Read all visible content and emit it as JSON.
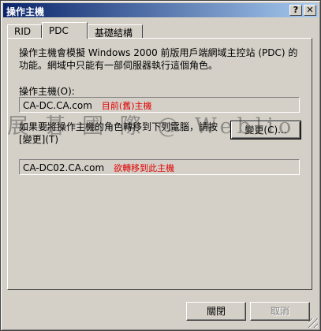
{
  "window": {
    "title": "操作主機",
    "help_glyph": "?",
    "close_glyph": "✕"
  },
  "tabs": [
    {
      "label": "RID",
      "active": false
    },
    {
      "label": "PDC",
      "active": true
    },
    {
      "label": "基礎結構",
      "active": false
    }
  ],
  "pdc": {
    "description": "操作主機會模擬 Windows 2000 前版用戶端網域主控站 (PDC) 的功能。網域中只能有一部伺服器執行這個角色。",
    "current_label": "操作主機(O):",
    "current_value": "CA-DC.CA.com",
    "current_annotation": "目前(舊)主機",
    "transfer_text": "如果要將操作主機的角色轉移到下列電腦，請按[變更](T)",
    "change_button": "變更(C)...",
    "target_value": "CA-DC02.CA.com",
    "target_annotation": "欲轉移到此主機"
  },
  "watermark": "展 碁 國 際 @ Weblio",
  "buttons": {
    "close": "關閉",
    "cancel": "取消"
  }
}
